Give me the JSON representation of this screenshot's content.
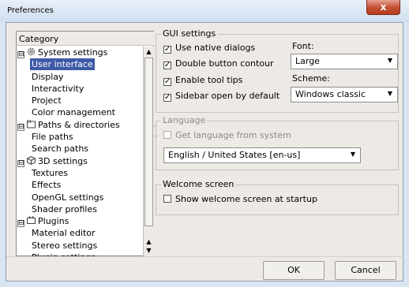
{
  "window": {
    "title": "Preferences",
    "close_glyph": "x"
  },
  "tree": {
    "header": "Category",
    "items": [
      {
        "label": "System settings",
        "kind": "parent",
        "icon": "gear-icon",
        "expander": "⊟"
      },
      {
        "label": "User interface",
        "kind": "child",
        "selected": true
      },
      {
        "label": "Display",
        "kind": "child"
      },
      {
        "label": "Interactivity",
        "kind": "child"
      },
      {
        "label": "Project",
        "kind": "child"
      },
      {
        "label": "Color management",
        "kind": "child"
      },
      {
        "label": "Paths & directories",
        "kind": "parent",
        "icon": "folder-icon",
        "expander": "⊟"
      },
      {
        "label": "File paths",
        "kind": "child"
      },
      {
        "label": "Search paths",
        "kind": "child"
      },
      {
        "label": "3D settings",
        "kind": "parent",
        "icon": "cube-icon",
        "expander": "⊟"
      },
      {
        "label": "Textures",
        "kind": "child"
      },
      {
        "label": "Effects",
        "kind": "child"
      },
      {
        "label": "OpenGL settings",
        "kind": "child"
      },
      {
        "label": "Shader profiles",
        "kind": "child"
      },
      {
        "label": "Plugins",
        "kind": "parent",
        "icon": "plugin-icon",
        "expander": "⊟"
      },
      {
        "label": "Material editor",
        "kind": "child"
      },
      {
        "label": "Stereo settings",
        "kind": "child"
      },
      {
        "label": "Plugin settings",
        "kind": "child"
      }
    ],
    "scroll_up_glyph": "▲",
    "scroll_down_glyph": "▼"
  },
  "gui": {
    "legend": "GUI settings",
    "checkboxes": [
      {
        "label": "Use native dialogs",
        "checked": true
      },
      {
        "label": "Double button contour",
        "checked": true
      },
      {
        "label": "Enable tool tips",
        "checked": true
      },
      {
        "label": "Sidebar open by default",
        "checked": true
      }
    ],
    "font_label": "Font:",
    "font_value": "Large",
    "scheme_label": "Scheme:",
    "scheme_value": "Windows classic"
  },
  "language": {
    "legend": "Language",
    "from_system_label": "Get language from system",
    "from_system_checked": false,
    "value": "English / United States  [en-us]"
  },
  "welcome": {
    "legend": "Welcome screen",
    "show_label": "Show welcome screen at startup",
    "show_checked": false
  },
  "buttons": {
    "ok": "OK",
    "cancel": "Cancel"
  },
  "glyphs": {
    "check": "✓",
    "dropdown": "▼"
  }
}
